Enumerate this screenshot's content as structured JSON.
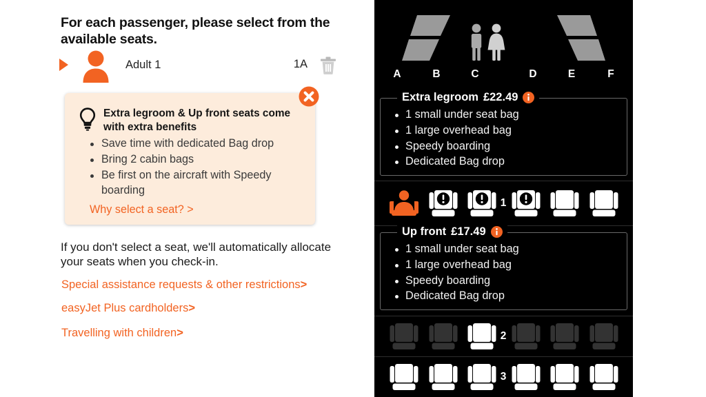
{
  "brand": {
    "orange": "#f26322",
    "tooltip_bg": "#fdecdc",
    "panel_bg": "#000000",
    "seat_available": "#ffffff",
    "seat_unavailable": "#333333"
  },
  "left": {
    "headline": "For each passenger, please select from the available seats.",
    "passenger": {
      "label": "Adult 1",
      "seat_code": "1A",
      "arrow_icon": "play-arrow-icon",
      "avatar_icon": "passenger-avatar-icon",
      "delete_icon": "trash-bin-icon"
    },
    "tooltip": {
      "bulb_icon": "lightbulb-icon",
      "close_icon": "close-circle-icon",
      "title": "Extra legroom & Up front seats come with extra benefits",
      "bullets": [
        "Save time with dedicated Bag drop",
        "Bring 2 cabin bags",
        "Be first on the aircraft with Speedy boarding"
      ],
      "link": "Why select a seat? >"
    },
    "auto_allocate_note": "If you don't select a seat, we'll automatically allocate your seats when you check-in.",
    "links": [
      {
        "label": "Special assistance requests & other restrictions",
        "chevron": ">"
      },
      {
        "label": "easyJet Plus cardholders",
        "chevron": ">"
      },
      {
        "label": "Travelling with children",
        "chevron": ">"
      }
    ]
  },
  "seatmap": {
    "column_letters": [
      "A",
      "B",
      "C",
      "D",
      "E",
      "F"
    ],
    "lavatory_icon": "toilets-man-woman-icon",
    "fares": [
      {
        "name": "Extra legroom",
        "price": "£22.49",
        "info_icon": "info-circle-icon",
        "benefits": [
          "1 small under seat bag",
          "1 large overhead bag",
          "Speedy boarding",
          "Dedicated Bag drop"
        ]
      },
      {
        "name": "Up front",
        "price": "£17.49",
        "info_icon": "info-circle-icon",
        "benefits": [
          "1 small under seat bag",
          "1 large overhead bag",
          "Speedy boarding",
          "Dedicated Bag drop"
        ]
      }
    ],
    "rows": [
      {
        "number": "1",
        "seats": [
          {
            "letter": "A",
            "state": "occupied"
          },
          {
            "letter": "B",
            "state": "restricted"
          },
          {
            "letter": "C",
            "state": "restricted"
          },
          {
            "letter": "D",
            "state": "restricted"
          },
          {
            "letter": "E",
            "state": "available"
          },
          {
            "letter": "F",
            "state": "available"
          }
        ]
      },
      {
        "number": "2",
        "seats": [
          {
            "letter": "A",
            "state": "unavailable"
          },
          {
            "letter": "B",
            "state": "unavailable"
          },
          {
            "letter": "C",
            "state": "available"
          },
          {
            "letter": "D",
            "state": "unavailable"
          },
          {
            "letter": "E",
            "state": "unavailable"
          },
          {
            "letter": "F",
            "state": "unavailable"
          }
        ]
      },
      {
        "number": "3",
        "seats": [
          {
            "letter": "A",
            "state": "available"
          },
          {
            "letter": "B",
            "state": "available"
          },
          {
            "letter": "C",
            "state": "available"
          },
          {
            "letter": "D",
            "state": "available"
          },
          {
            "letter": "E",
            "state": "available"
          },
          {
            "letter": "F",
            "state": "available"
          }
        ]
      }
    ]
  }
}
